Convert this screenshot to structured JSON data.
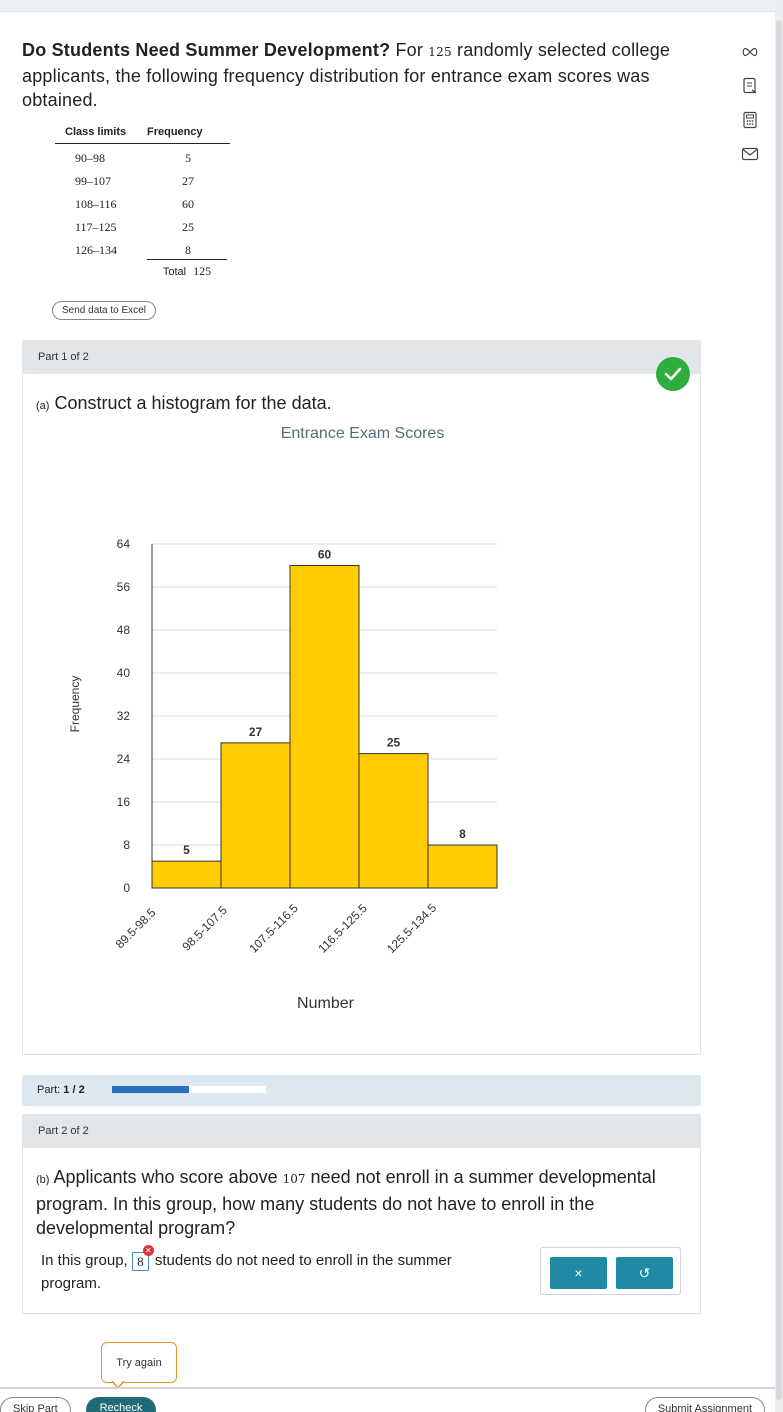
{
  "problem": {
    "title": "Do Students Need Summer Development?",
    "text_a": "For",
    "n": "125",
    "text_b": "randomly selected college applicants, the following frequency distribution for entrance exam scores was obtained."
  },
  "table": {
    "col_class": "Class limits",
    "col_freq": "Frequency",
    "rows": [
      {
        "cls": "90–98",
        "freq": "5"
      },
      {
        "cls": "99–107",
        "freq": "27"
      },
      {
        "cls": "108–116",
        "freq": "60"
      },
      {
        "cls": "117–125",
        "freq": "25"
      },
      {
        "cls": "126–134",
        "freq": "8"
      }
    ],
    "total_label": "Total",
    "total_value": "125"
  },
  "excel_button": "Send data to Excel",
  "part1": {
    "header": "Part 1 of 2",
    "label": "(a)",
    "question": "Construct a histogram for the data."
  },
  "chart_data": {
    "type": "bar",
    "title": "Entrance Exam Scores",
    "xlabel": "Number",
    "ylabel": "Frequency",
    "categories": [
      "89.5-98.5",
      "98.5-107.5",
      "107.5-116.5",
      "116.5-125.5",
      "125.5-134.5"
    ],
    "values": [
      5,
      27,
      60,
      25,
      8
    ],
    "ylim": [
      0,
      64
    ],
    "yticks": [
      0,
      8,
      16,
      24,
      32,
      40,
      48,
      56,
      64
    ],
    "grid": true,
    "bar_color": "#ffcc00"
  },
  "progress": {
    "label_prefix": "Part:",
    "label_value": "1 / 2",
    "fraction": 0.5
  },
  "part2": {
    "header": "Part 2 of 2",
    "label": "(b)",
    "q_a": "Applicants who score above",
    "q_num": "107",
    "q_b": "need not enroll in a summer developmental program. In this group, how many students do not have to enroll in the developmental program?",
    "answer_prefix": "In this group,",
    "answer_value": "8",
    "answer_suffix": "students do not need to enroll in the summer program.",
    "clear_symbol": "×",
    "undo_symbol": "↺"
  },
  "try_again": "Try again",
  "bottom": {
    "skip": "Skip Part",
    "recheck": "Recheck",
    "submit": "Submit Assignment"
  }
}
